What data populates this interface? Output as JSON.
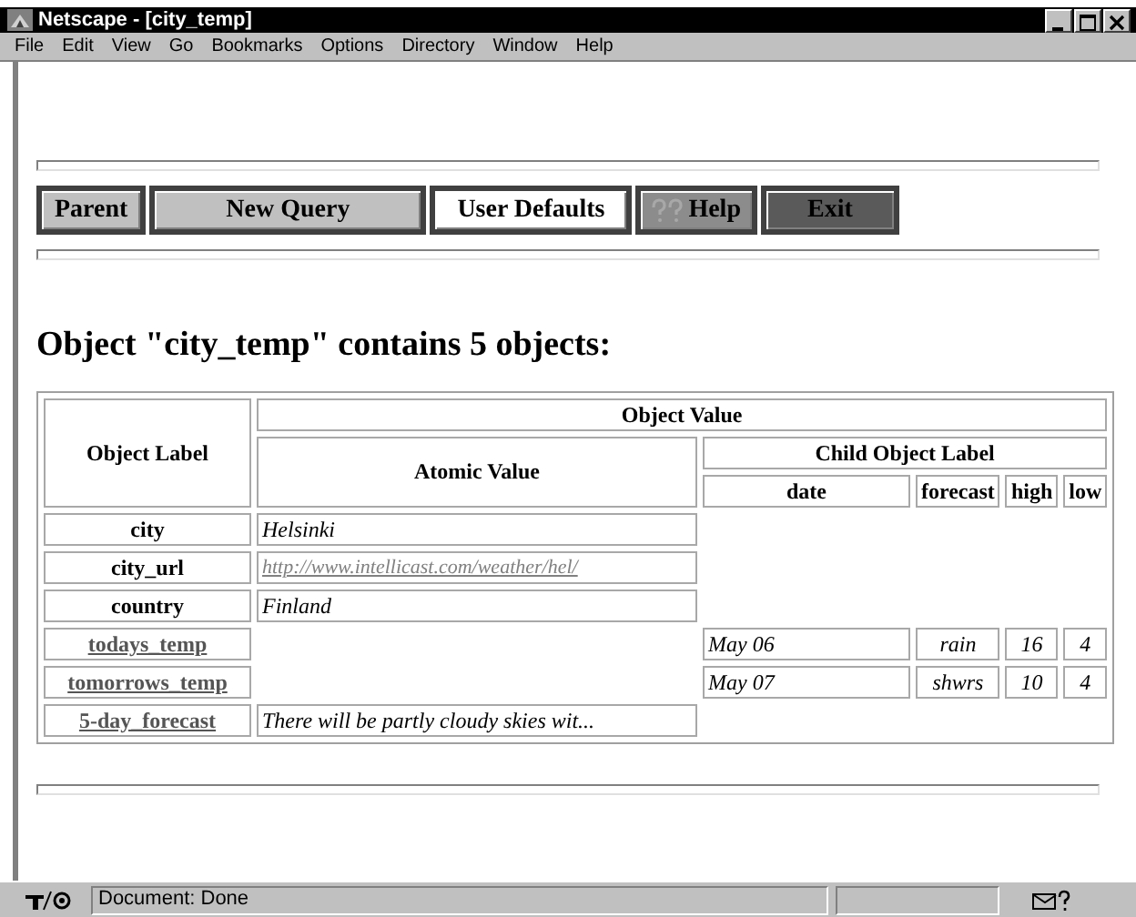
{
  "window": {
    "title": "Netscape - [city_temp]"
  },
  "menu": [
    "File",
    "Edit",
    "View",
    "Go",
    "Bookmarks",
    "Options",
    "Directory",
    "Window",
    "Help"
  ],
  "toolbar": {
    "buttons": [
      {
        "label": "Parent",
        "color": "#c0c0c0",
        "kind": "text"
      },
      {
        "label": "New Query",
        "color": "#c0c0c0",
        "kind": "text"
      },
      {
        "label": "User Defaults",
        "color": "#ffffff",
        "kind": "text"
      },
      {
        "label": "Help",
        "color": "#8c8c8c",
        "kind": "help"
      },
      {
        "label": "Exit",
        "color": "#5a5a5a",
        "kind": "text"
      }
    ]
  },
  "heading": "Object \"city_temp\" contains 5 objects:",
  "table": {
    "headers": {
      "label": "Object Label",
      "value": "Object Value",
      "atomic": "Atomic Value",
      "child": "Child Object Label",
      "child_columns": [
        "date",
        "forecast",
        "high",
        "low"
      ]
    },
    "rows": [
      {
        "label": "city",
        "link": false,
        "atomic": "Helsinki",
        "atomic_link": false
      },
      {
        "label": "city_url",
        "link": false,
        "atomic": "http://www.intellicast.com/weather/hel/",
        "atomic_link": true
      },
      {
        "label": "country",
        "link": false,
        "atomic": "Finland",
        "atomic_link": false
      },
      {
        "label": "todays_temp",
        "link": true,
        "children": [
          "May 06",
          "rain",
          "16",
          "4"
        ]
      },
      {
        "label": "tomorrows_temp",
        "link": true,
        "children": [
          "May 07",
          "shwrs",
          "10",
          "4"
        ]
      },
      {
        "label": "5-day_forecast",
        "link": true,
        "atomic": "There will be partly cloudy skies wit...",
        "atomic_link": false
      }
    ]
  },
  "status_bar": {
    "text": "Document: Done"
  }
}
